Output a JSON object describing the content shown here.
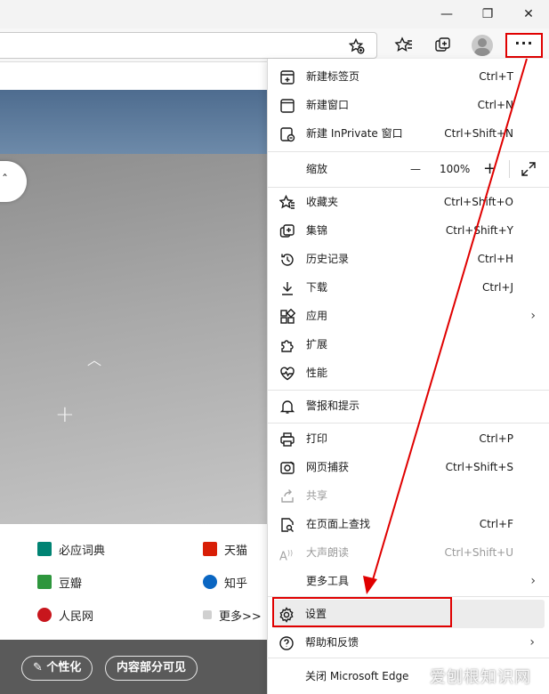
{
  "window": {
    "minimize_glyph": "—",
    "restore_glyph": "❐",
    "close_glyph": "✕"
  },
  "toolbar": {
    "more_glyph": "···",
    "icons": [
      "favorite-add-icon",
      "favorites-icon",
      "collections-icon",
      "profile-icon"
    ]
  },
  "page": {
    "tiles": [
      {
        "label": "必应词典",
        "color": "#008373"
      },
      {
        "label": "天猫",
        "color": "#d81e06"
      },
      {
        "label": "豆瓣",
        "color": "#2e963d"
      },
      {
        "label": "知乎",
        "color": "#0a66c2"
      },
      {
        "label": "人民网",
        "color": "#c8161d"
      },
      {
        "label": "更多>>",
        "color": "#bbbbbb"
      }
    ],
    "personalize_label": "个性化",
    "visibility_label": "内容部分可见"
  },
  "menu": {
    "new_tab": {
      "label": "新建标签页",
      "shortcut": "Ctrl+T"
    },
    "new_window": {
      "label": "新建窗口",
      "shortcut": "Ctrl+N"
    },
    "new_inprivate": {
      "label": "新建 InPrivate 窗口",
      "shortcut": "Ctrl+Shift+N"
    },
    "zoom": {
      "label": "缩放",
      "minus": "—",
      "value": "100%",
      "plus": "+"
    },
    "favorites": {
      "label": "收藏夹",
      "shortcut": "Ctrl+Shift+O"
    },
    "collections": {
      "label": "集锦",
      "shortcut": "Ctrl+Shift+Y"
    },
    "history": {
      "label": "历史记录",
      "shortcut": "Ctrl+H"
    },
    "downloads": {
      "label": "下载",
      "shortcut": "Ctrl+J"
    },
    "apps": {
      "label": "应用"
    },
    "extensions": {
      "label": "扩展"
    },
    "performance": {
      "label": "性能"
    },
    "alerts": {
      "label": "警报和提示"
    },
    "print": {
      "label": "打印",
      "shortcut": "Ctrl+P"
    },
    "web_capture": {
      "label": "网页捕获",
      "shortcut": "Ctrl+Shift+S"
    },
    "share": {
      "label": "共享"
    },
    "find": {
      "label": "在页面上查找",
      "shortcut": "Ctrl+F"
    },
    "read_aloud": {
      "label": "大声朗读",
      "shortcut": "Ctrl+Shift+U"
    },
    "more_tools": {
      "label": "更多工具"
    },
    "settings": {
      "label": "设置"
    },
    "help": {
      "label": "帮助和反馈"
    },
    "close_edge": {
      "label": "关闭 Microsoft Edge"
    }
  },
  "watermark": "爱刨根知识网",
  "colors": {
    "annotation": "#e00000",
    "menu_hover": "#ececec"
  }
}
